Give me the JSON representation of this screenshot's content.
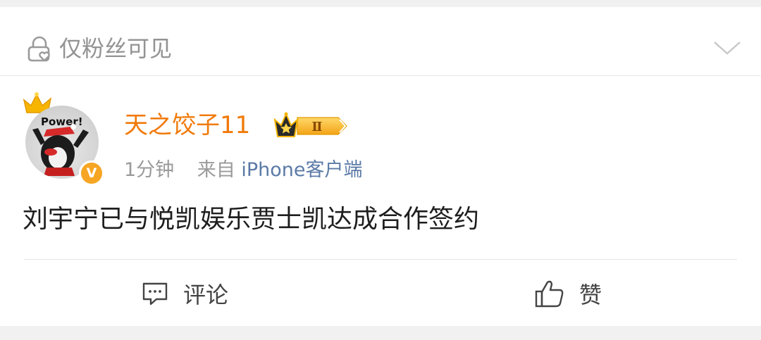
{
  "visibility": {
    "label": "仅粉丝可见",
    "lock_icon": "lock-heart-icon",
    "expand_icon": "chevron-down-icon"
  },
  "post": {
    "author": {
      "name": "天之饺子11",
      "avatar_text": "Power!",
      "verified_badge": "V",
      "vip_level": "Ⅱ",
      "name_color": "#f17a0a"
    },
    "time": "1分钟",
    "source_prefix": "来自",
    "source": "iPhone客户端",
    "content": "刘宇宁已与悦凯娱乐贾士凯达成合作签约"
  },
  "actions": {
    "comment_label": "评论",
    "comment_icon": "comment-icon",
    "like_label": "赞",
    "like_icon": "thumbs-up-icon"
  },
  "colors": {
    "accent_orange": "#f17a0a",
    "link_blue": "#5b7aa6",
    "badge_gold": "#f6a623"
  }
}
